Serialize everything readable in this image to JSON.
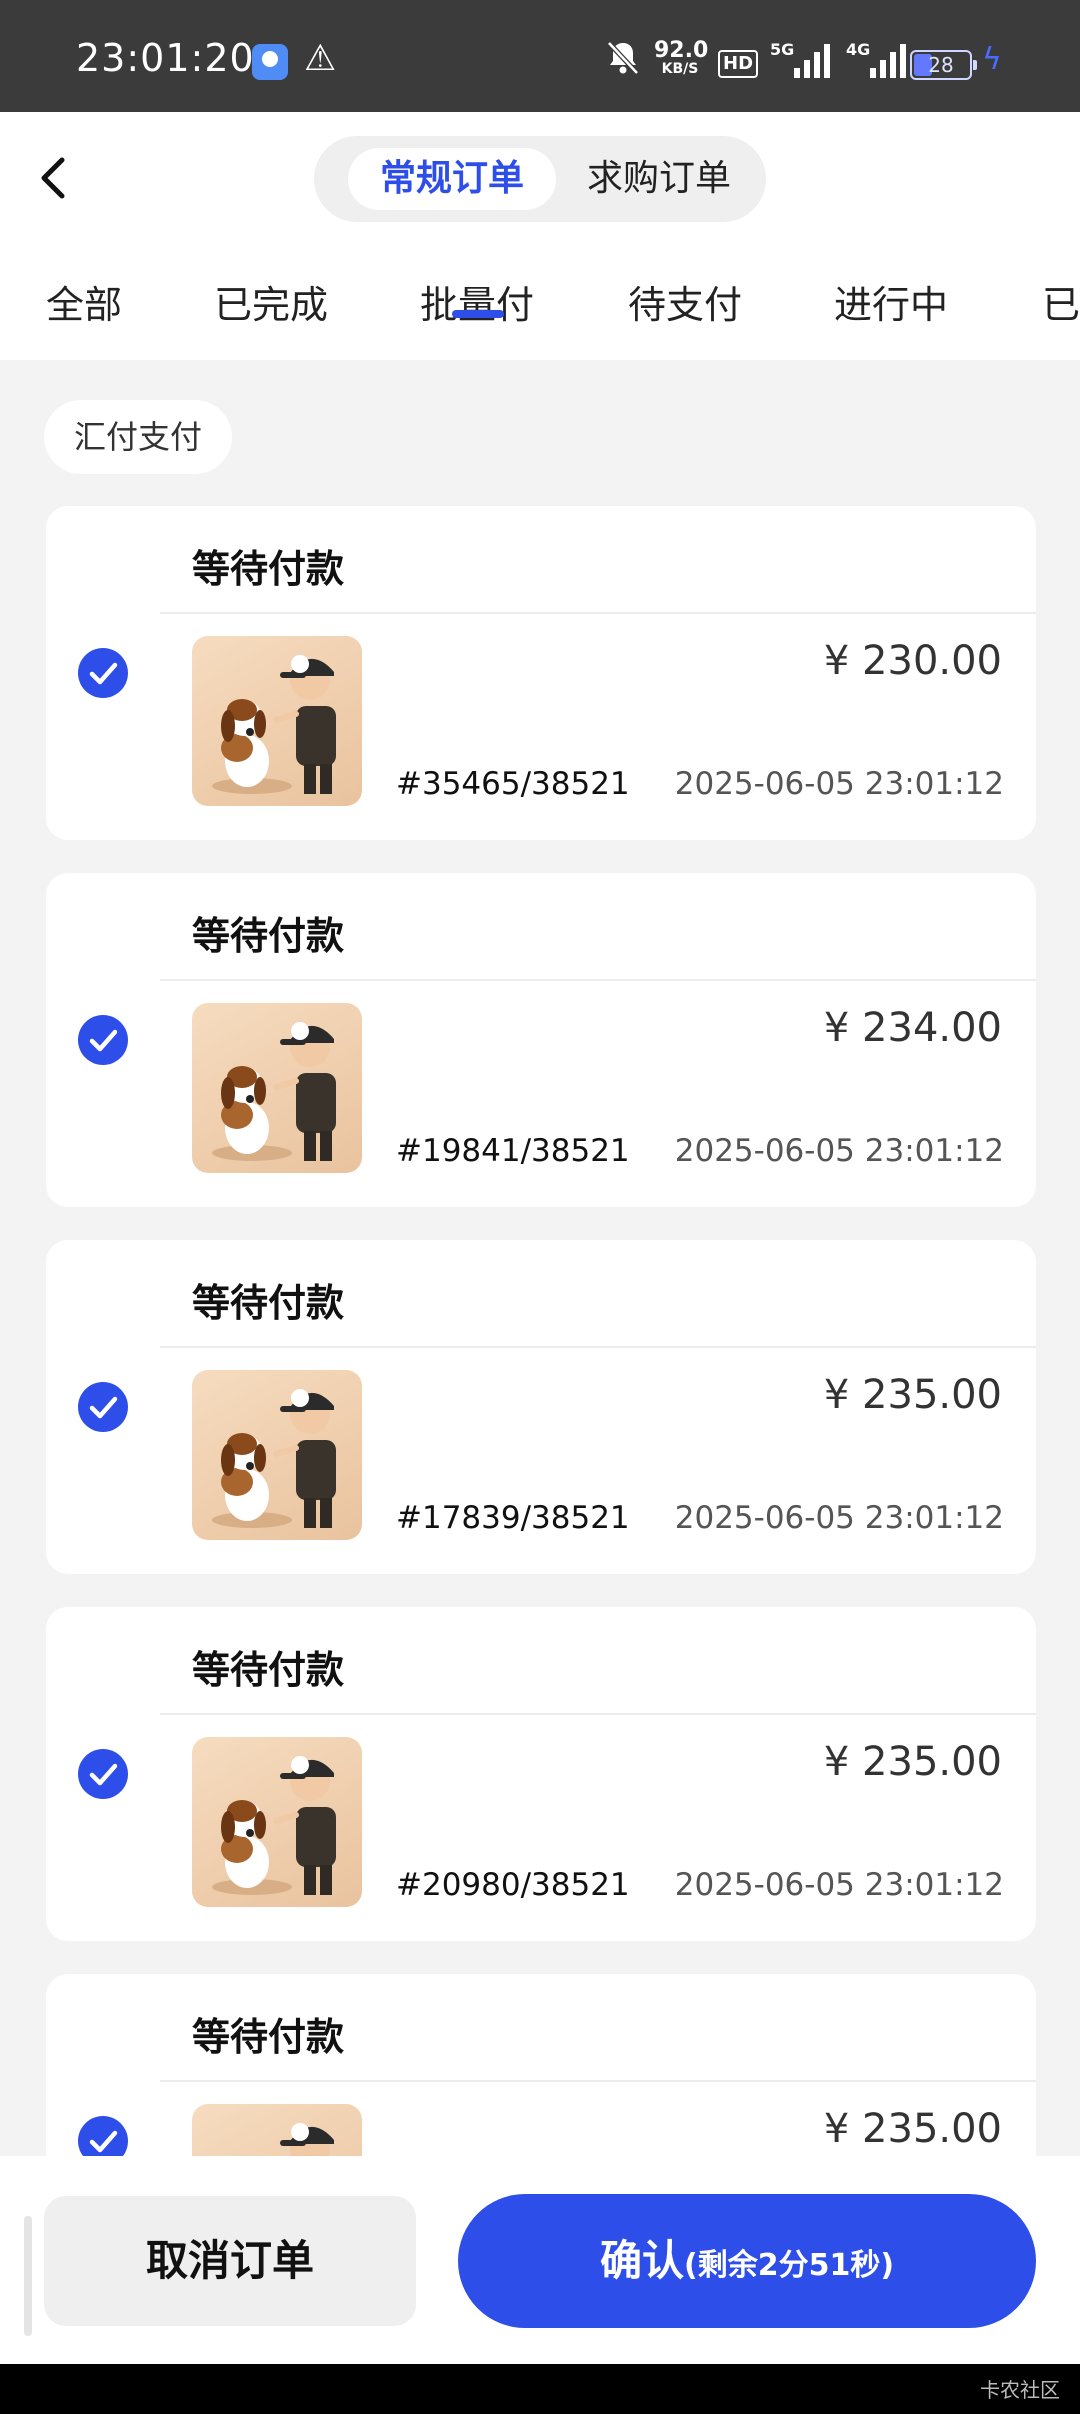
{
  "status_bar": {
    "time": "23:01:20",
    "speed_value": "92.0",
    "speed_unit": "KB/S",
    "hd_label": "HD",
    "signal_1_label": "5G",
    "signal_2_label": "4G",
    "battery_level": "28"
  },
  "header": {
    "segments": [
      {
        "label": "常规订单",
        "active": true
      },
      {
        "label": "求购订单",
        "active": false
      }
    ],
    "tabs": [
      {
        "label": "全部"
      },
      {
        "label": "已完成"
      },
      {
        "label": "批量付",
        "active": true
      },
      {
        "label": "待支付"
      },
      {
        "label": "进行中"
      },
      {
        "label": "已"
      }
    ]
  },
  "filter": {
    "chip_label": "汇付支付"
  },
  "orders": [
    {
      "status": "等待付款",
      "price": "¥ 230.00",
      "order_no": "#35465/38521",
      "time": "2025-06-05 23:01:12",
      "checked": true
    },
    {
      "status": "等待付款",
      "price": "¥ 234.00",
      "order_no": "#19841/38521",
      "time": "2025-06-05 23:01:12",
      "checked": true
    },
    {
      "status": "等待付款",
      "price": "¥ 235.00",
      "order_no": "#17839/38521",
      "time": "2025-06-05 23:01:12",
      "checked": true
    },
    {
      "status": "等待付款",
      "price": "¥ 235.00",
      "order_no": "#20980/38521",
      "time": "2025-06-05 23:01:12",
      "checked": true
    },
    {
      "status": "等待付款",
      "price": "¥ 235.00",
      "order_no": "",
      "time": "",
      "checked": true
    }
  ],
  "bottom": {
    "cancel_label": "取消订单",
    "confirm_label": "确认",
    "countdown_label": "(剩余2分51秒)"
  },
  "colors": {
    "accent": "#2d4ee8",
    "background": "#f3f3f3"
  },
  "watermark": "卡农社区"
}
